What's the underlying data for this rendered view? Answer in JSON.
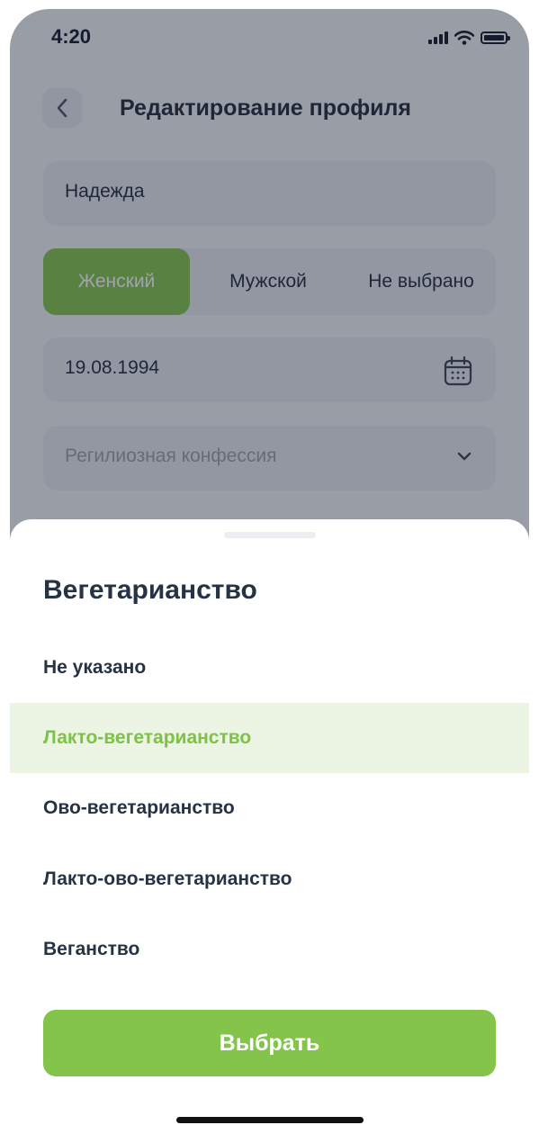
{
  "status_bar": {
    "time": "4:20"
  },
  "header": {
    "title": "Редактирование профиля"
  },
  "form": {
    "name_value": "Надежда",
    "gender_options": [
      "Женский",
      "Мужской",
      "Не выбрано"
    ],
    "gender_selected": "Женский",
    "birth_date": "19.08.1994",
    "religion_placeholder": "Регилиозная конфессия"
  },
  "sheet": {
    "title": "Вегетарианство",
    "options": [
      {
        "label": "Не указано",
        "selected": false
      },
      {
        "label": "Лакто-вегетарианство",
        "selected": true
      },
      {
        "label": "Ово-вегетарианство",
        "selected": false
      },
      {
        "label": "Лакто-ово-вегетарианство",
        "selected": false
      },
      {
        "label": "Веганство",
        "selected": false
      }
    ],
    "select_label": "Выбрать"
  },
  "colors": {
    "accent": "#84c44a",
    "selected_text": "#7dc244",
    "selected_bg": "#ecf5e4",
    "text_primary": "#263344"
  },
  "icons": [
    "back-chevron-icon",
    "calendar-icon",
    "chevron-down-icon",
    "cellular-signal-icon",
    "wifi-icon",
    "battery-icon"
  ]
}
